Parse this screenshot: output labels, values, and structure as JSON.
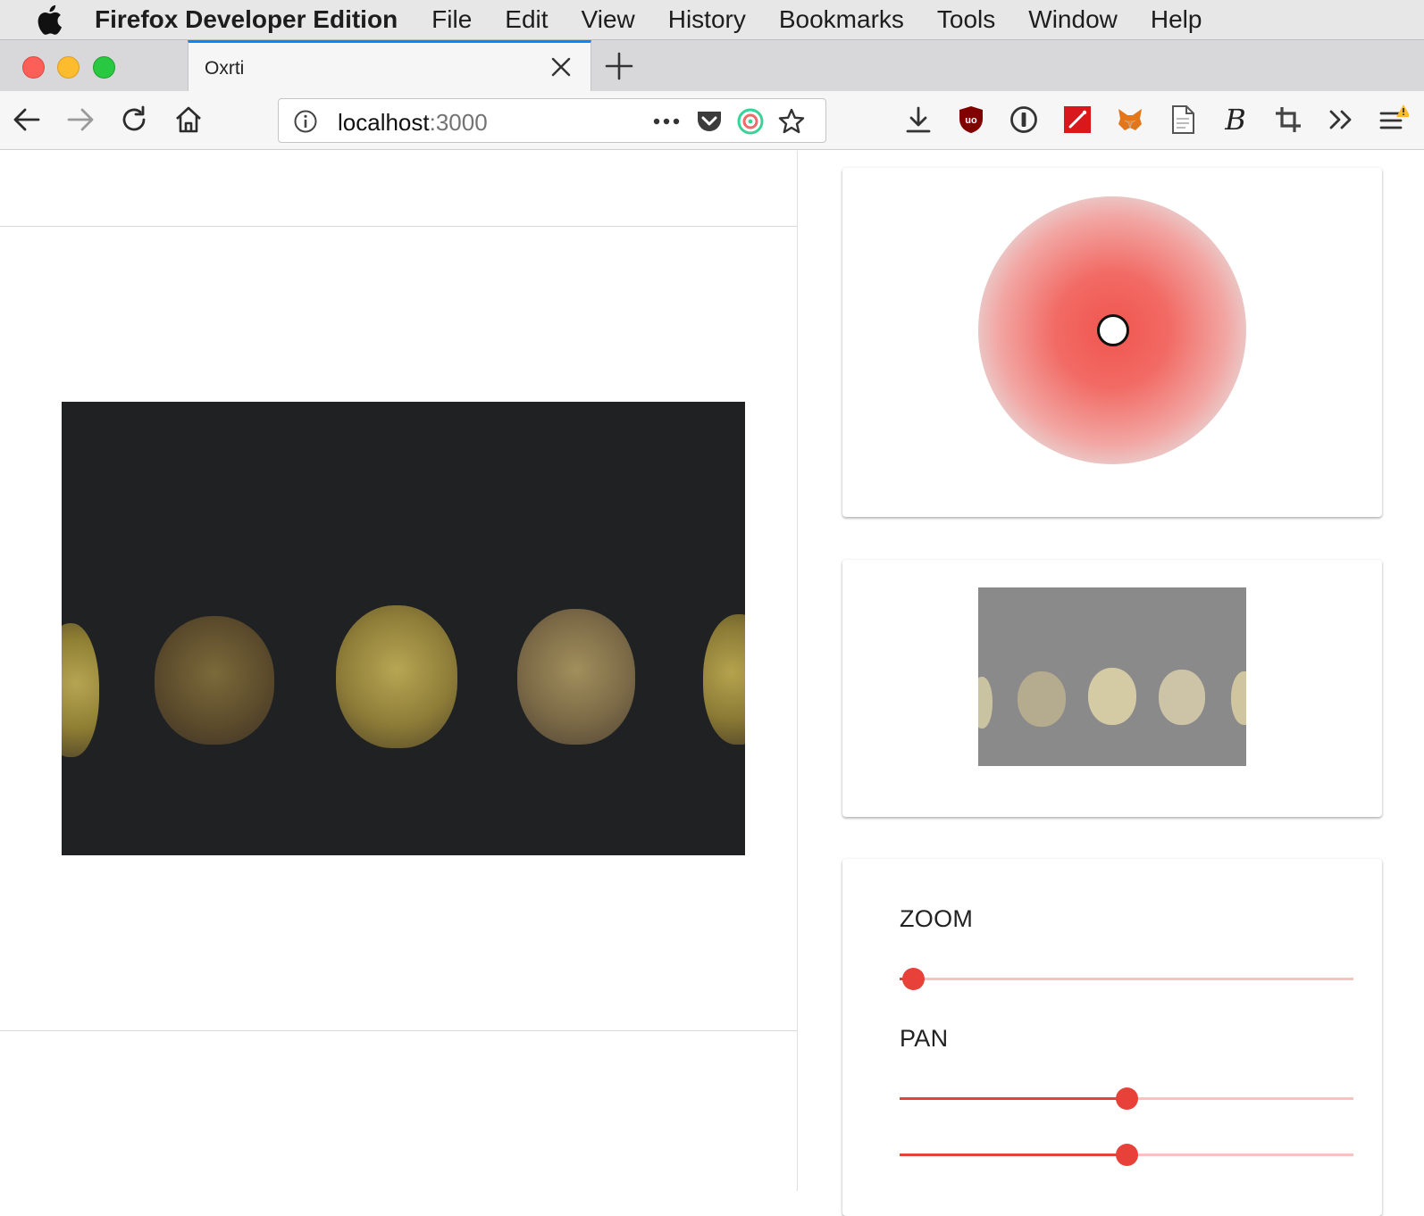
{
  "os_menubar": {
    "app_name": "Firefox Developer Edition",
    "items": [
      "File",
      "Edit",
      "View",
      "History",
      "Bookmarks",
      "Tools",
      "Window",
      "Help"
    ]
  },
  "browser": {
    "tab": {
      "title": "Oxrti"
    },
    "url": {
      "host": "localhost",
      "port": ":3000"
    },
    "toolbar_icons": [
      "download-icon",
      "ublock-icon",
      "onepassword-icon",
      "wand-extension-icon",
      "metamask-fox-icon",
      "reader-page-icon",
      "bold-b-extension-icon",
      "crop-icon",
      "overflow-chevrons-icon",
      "hamburger-menu-icon"
    ]
  },
  "controls": {
    "zoom_label": "ZOOM",
    "pan_label": "PAN",
    "zoom_value": 0.03,
    "pan_x_value": 0.5,
    "pan_y_value": 0.5
  },
  "colors": {
    "accent": "#e8413a",
    "tab_highlight": "#0a84ff"
  }
}
